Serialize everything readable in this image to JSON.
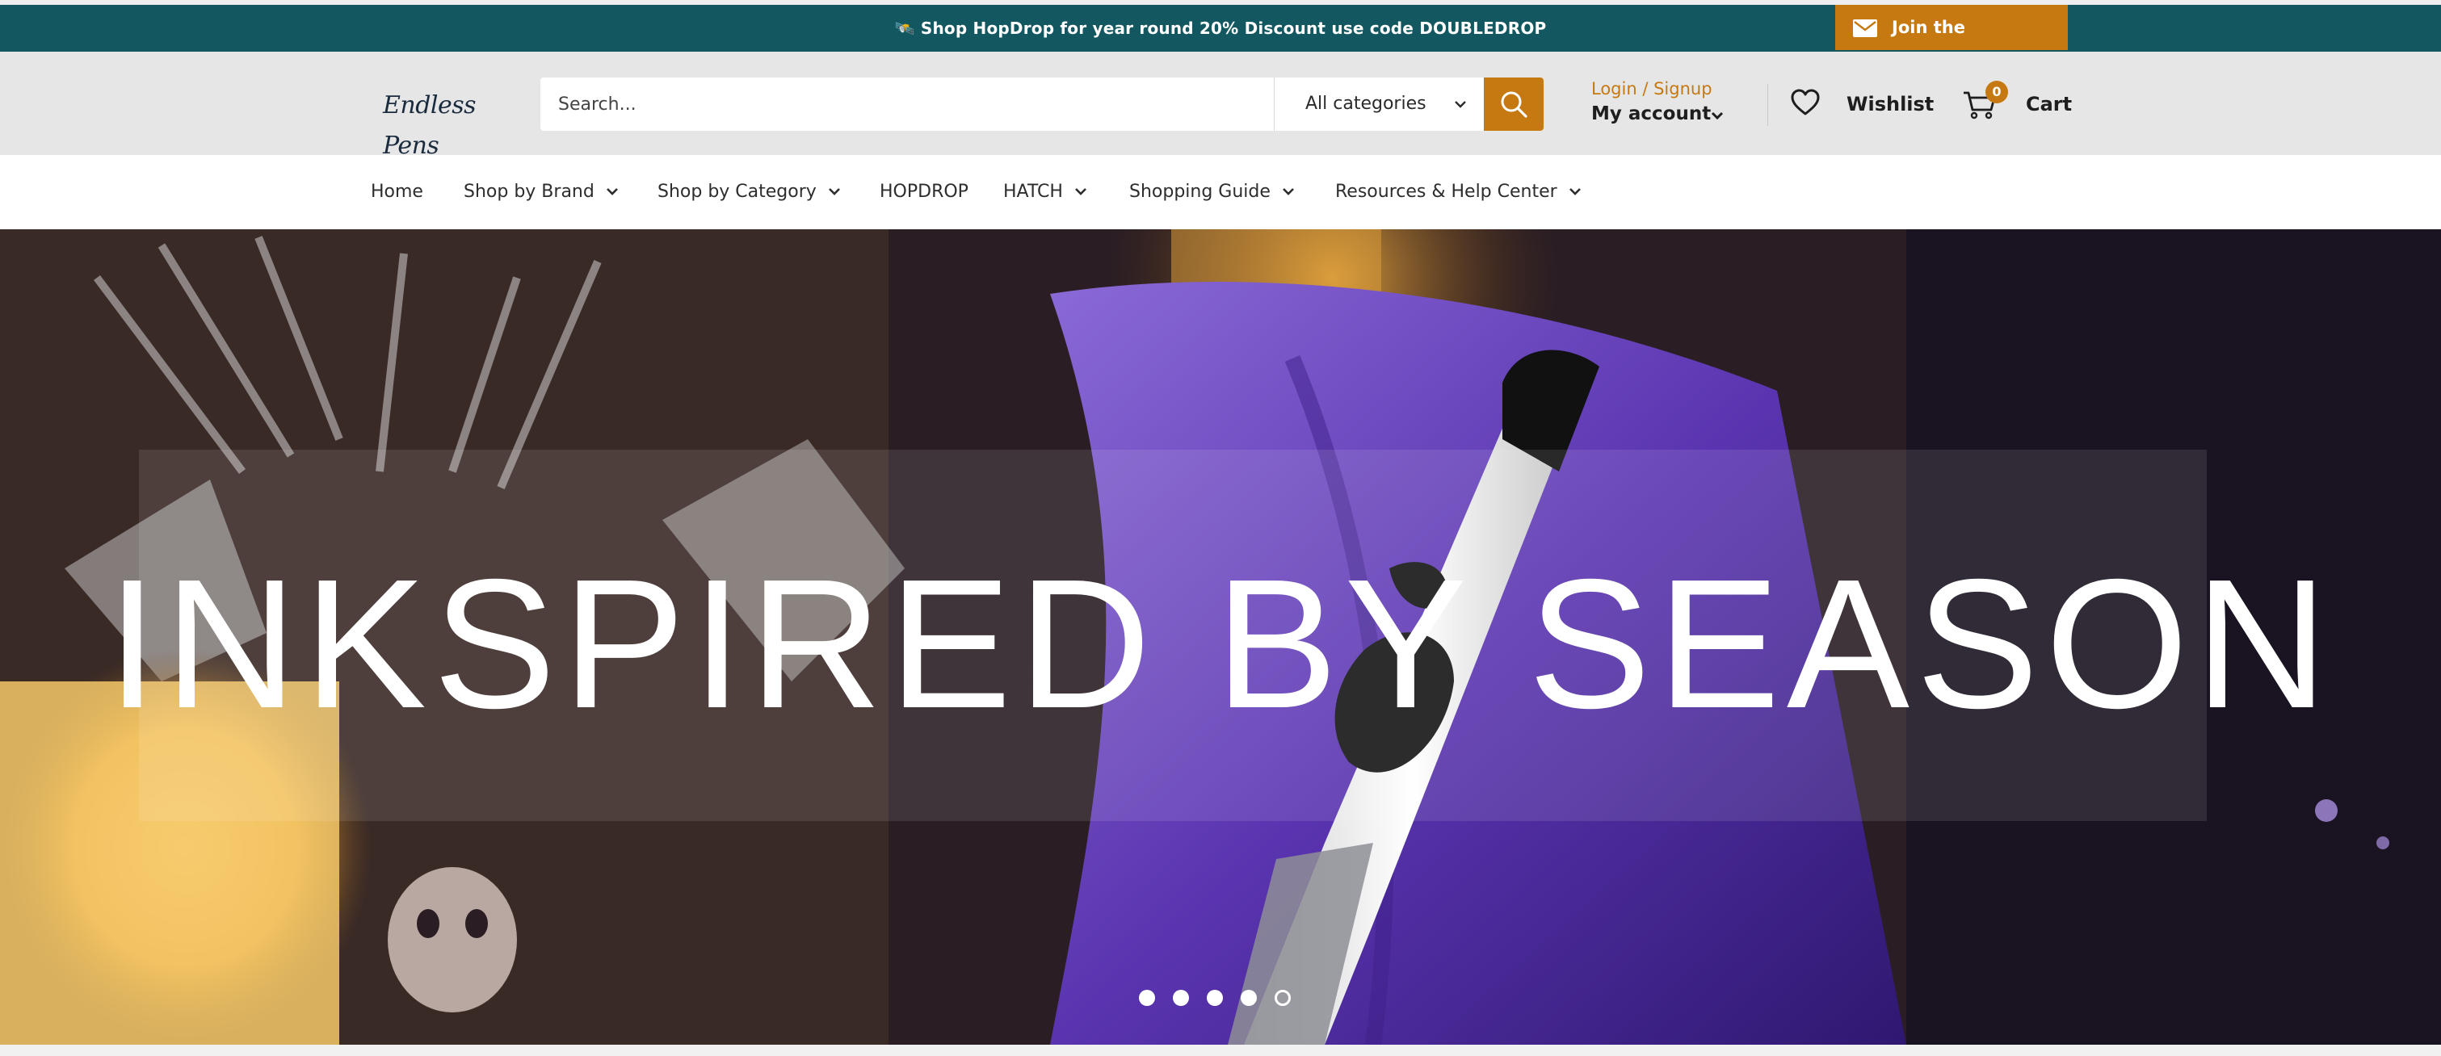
{
  "announcement": {
    "icon": "rocket-icon",
    "text": "🛰️ Shop HopDrop for year round 20% Discount use code DOUBLEDROP",
    "newsletter_label": "Join the Newsletter"
  },
  "header": {
    "logo_text": "Endless Pens",
    "search": {
      "placeholder": "Search...",
      "value": ""
    },
    "category_select": "All categories",
    "account": {
      "login_label": "Login / Signup",
      "my_account_label": "My account"
    },
    "wishlist_label": "Wishlist",
    "cart": {
      "label": "Cart",
      "count": "0"
    }
  },
  "nav": {
    "items": [
      {
        "label": "Home",
        "has_dropdown": false
      },
      {
        "label": "Shop by Brand",
        "has_dropdown": true
      },
      {
        "label": "Shop by Category",
        "has_dropdown": true
      },
      {
        "label": "HOPDROP",
        "has_dropdown": false
      },
      {
        "label": "HATCH",
        "has_dropdown": true
      },
      {
        "label": "Shopping Guide",
        "has_dropdown": true
      },
      {
        "label": "Resources & Help Center",
        "has_dropdown": true
      }
    ]
  },
  "hero": {
    "headline": "INKSPIRED BY SEASON",
    "slide_count": 5,
    "active_slide": 5
  },
  "colors": {
    "announcement_bg": "#135760",
    "accent": "#c77911",
    "header_bg": "#e6e6e6"
  }
}
